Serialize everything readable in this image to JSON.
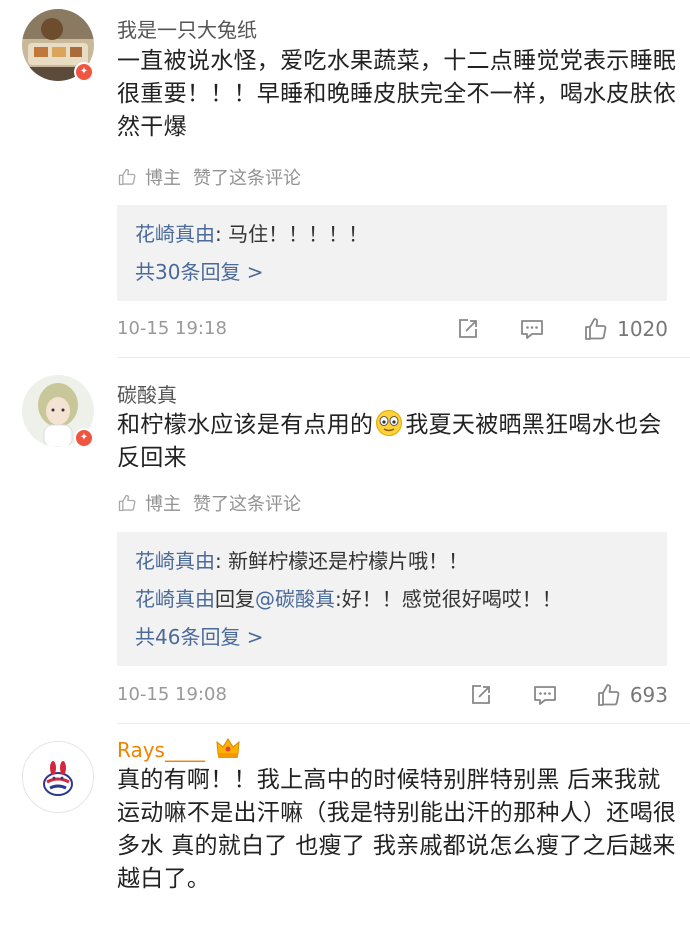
{
  "comments": [
    {
      "username": "我是一只大兔纸",
      "text": "一直被说水怪，爱吃水果蔬菜，十二点睡觉党表示睡眠很重要！！！早睡和晚睡皮肤完全不一样，喝水皮肤依然干爆",
      "author_label": "博主",
      "liked_text": "赞了这条评论",
      "replies": [
        {
          "name": "花崎真由",
          "sep": ": ",
          "text": "马住！！！！！"
        }
      ],
      "more_replies": "共30条回复 >",
      "time": "10-15 19:18",
      "likes": "1020"
    },
    {
      "username": "碳酸真",
      "text_before": "和柠檬水应该是有点用的",
      "text_after": "我夏天被晒黑狂喝水也会反回来",
      "emoji": "crying-laughing-emoji",
      "author_label": "博主",
      "liked_text": "赞了这条评论",
      "replies": [
        {
          "name": "花崎真由",
          "sep": ": ",
          "text": "新鲜柠檬还是柠檬片哦！！"
        },
        {
          "name": "花崎真由",
          "mid": "回复",
          "mention": "@碳酸真",
          "sep": ":",
          "text": "好！！感觉很好喝哎！！"
        }
      ],
      "more_replies": "共46条回复 >",
      "time": "10-15 19:08",
      "likes": "693"
    },
    {
      "username": "Rays____",
      "badge": "crown-icon",
      "text": "真的有啊！！我上高中的时候特别胖特别黑 后来我就运动嘛不是出汗嘛（我是特别能出汗的那种人）还喝很多水 真的就白了 也瘦了 我亲戚都说怎么瘦了之后越来越白了。"
    }
  ],
  "colors": {
    "link": "#4a6a9a",
    "username_vip": "#f08300",
    "badge": "#f0553f",
    "reply_bg": "#f2f2f2"
  }
}
